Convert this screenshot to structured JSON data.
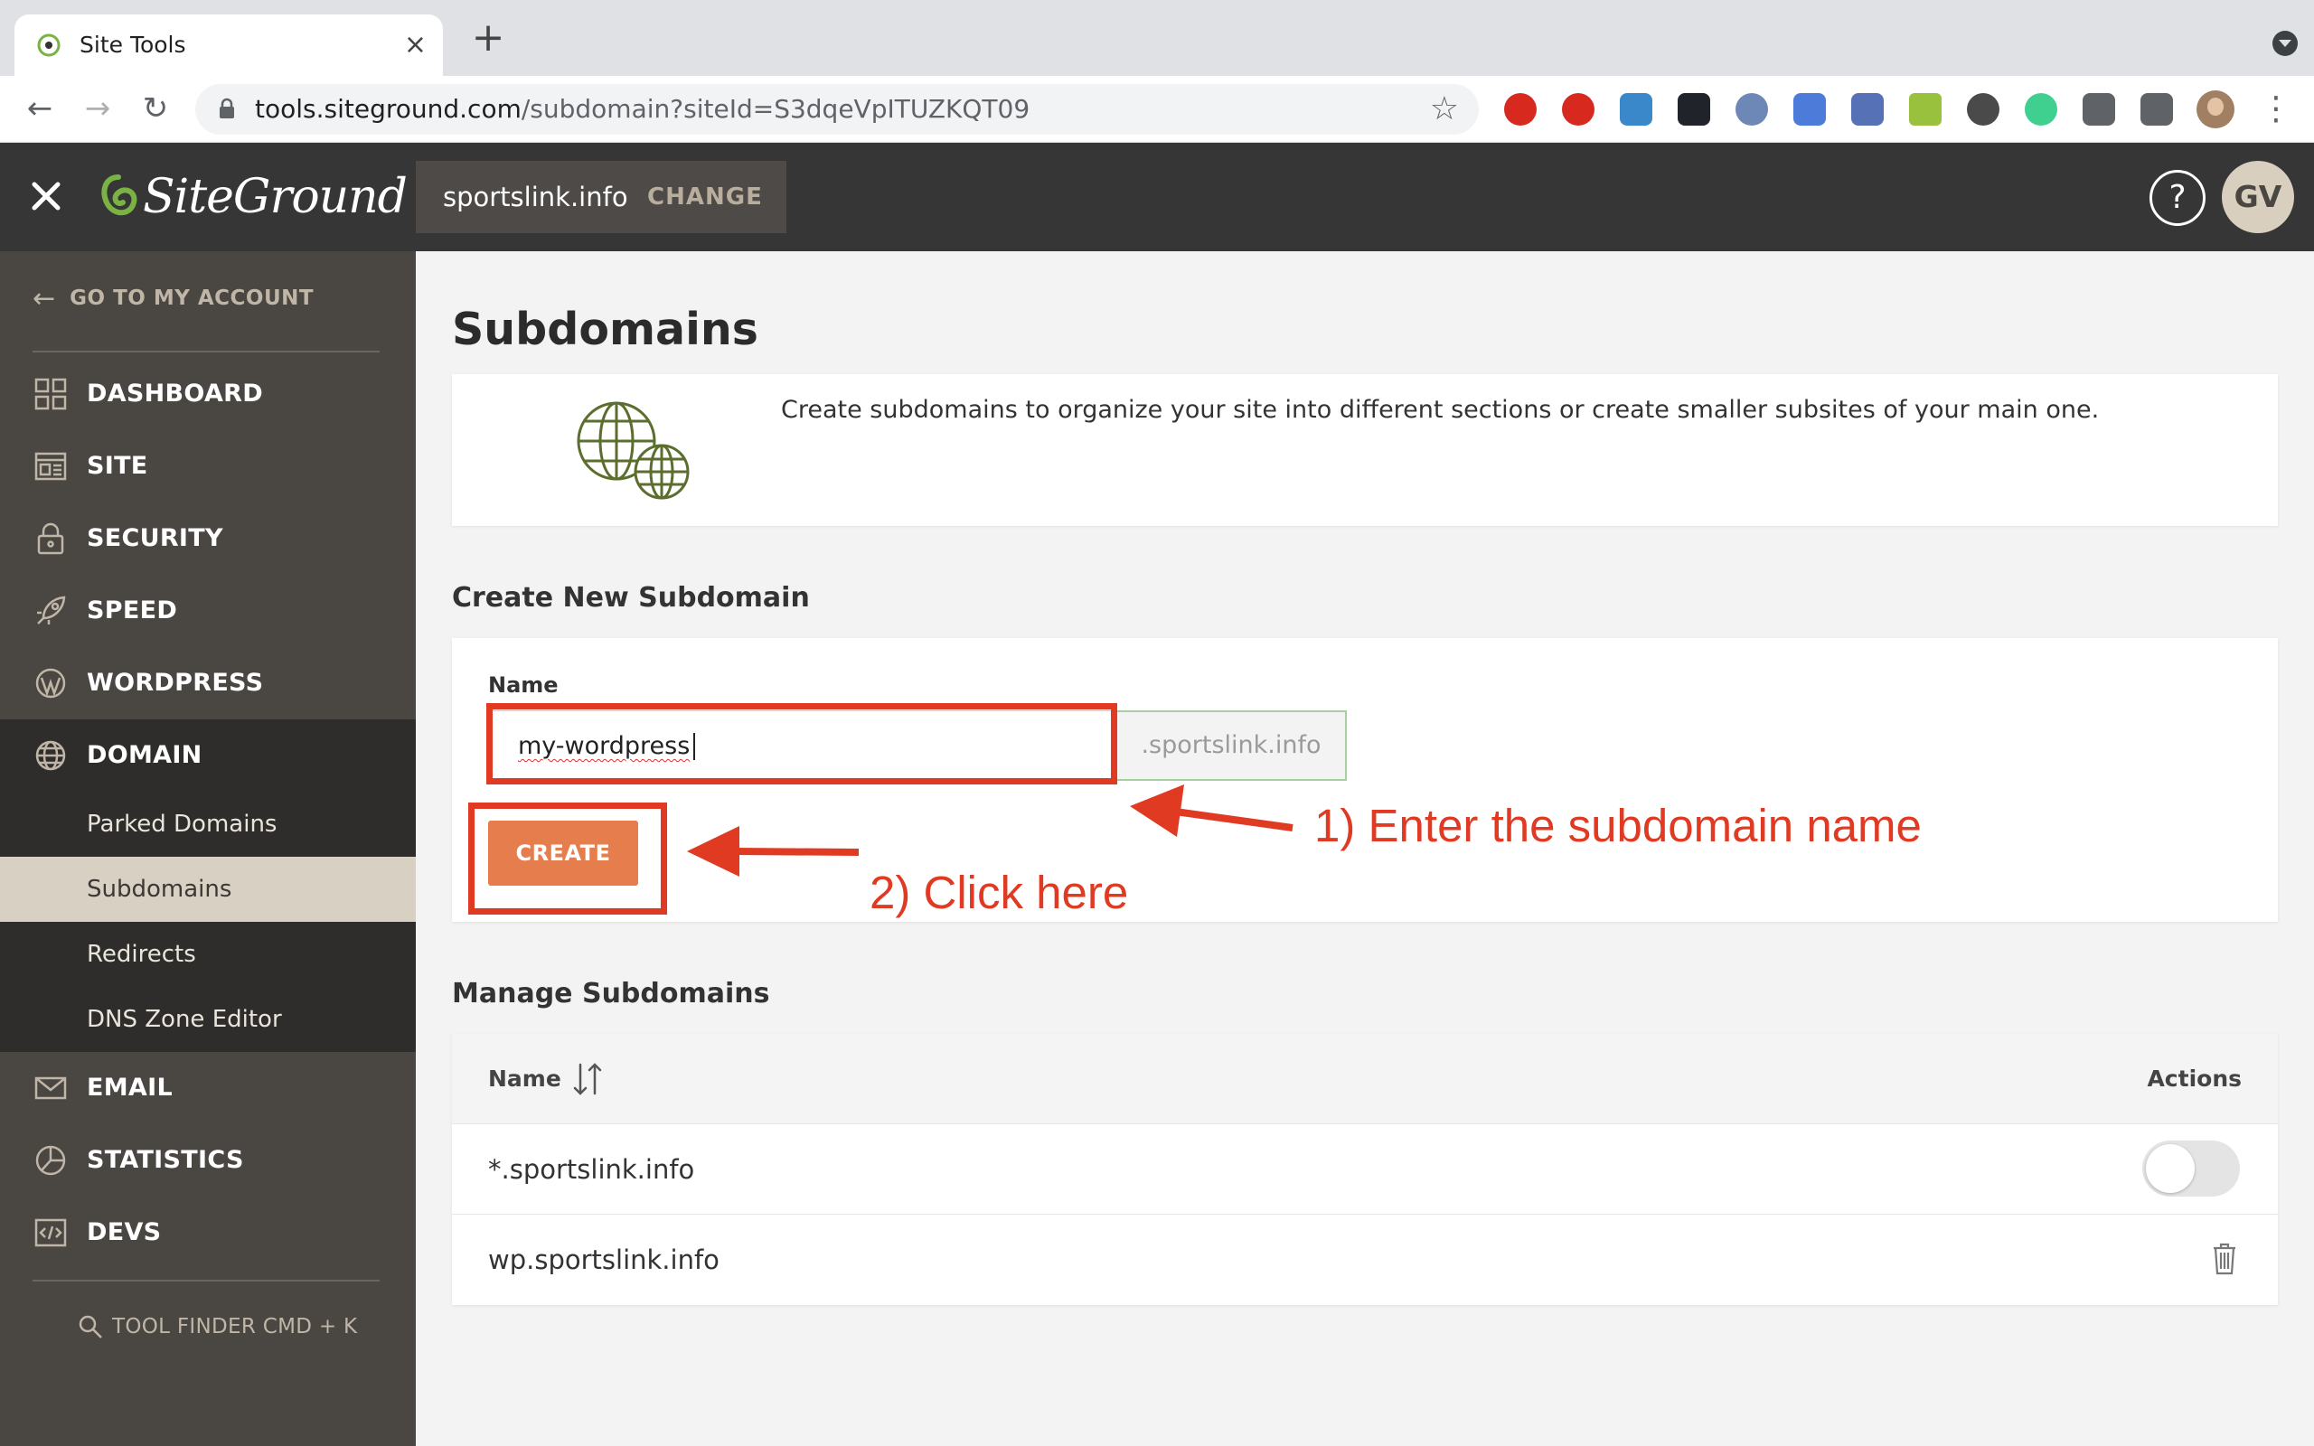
{
  "browser": {
    "tab_title": "Site Tools",
    "tab_close": "×",
    "new_tab": "+",
    "url_host": "tools.siteground.com",
    "url_path": "/subdomain?siteId=S3dqeVpITUZKQT09"
  },
  "header": {
    "logo_text": "SiteGround",
    "site_name": "sportslink.info",
    "change_label": "CHANGE",
    "help_label": "?",
    "user_initials": "GV"
  },
  "sidebar": {
    "back_label": "GO TO MY ACCOUNT",
    "items": [
      {
        "label": "DASHBOARD"
      },
      {
        "label": "SITE"
      },
      {
        "label": "SECURITY"
      },
      {
        "label": "SPEED"
      },
      {
        "label": "WORDPRESS"
      },
      {
        "label": "DOMAIN"
      },
      {
        "label": "EMAIL"
      },
      {
        "label": "STATISTICS"
      },
      {
        "label": "DEVS"
      }
    ],
    "domain_subitems": [
      {
        "label": "Parked Domains"
      },
      {
        "label": "Subdomains"
      },
      {
        "label": "Redirects"
      },
      {
        "label": "DNS Zone Editor"
      }
    ],
    "tool_finder": "TOOL FINDER CMD + K"
  },
  "main": {
    "title": "Subdomains",
    "intro": "Create subdomains to organize your site into different sections or create smaller subsites of your main one.",
    "create_section": {
      "title": "Create New Subdomain",
      "name_label": "Name",
      "name_value": "my-wordpress",
      "suffix": ".sportslink.info",
      "create_button": "CREATE"
    },
    "manage_section": {
      "title": "Manage Subdomains",
      "col_name": "Name",
      "col_actions": "Actions",
      "rows": [
        {
          "name": "*.sportslink.info"
        },
        {
          "name": "wp.sportslink.info"
        }
      ]
    }
  },
  "annotations": {
    "step1": "1) Enter the subdomain name",
    "step2": "2) Click here"
  },
  "colors": {
    "accent": "#e67d4c",
    "annotation": "#e03a23",
    "sidebar": "#4a4642",
    "header": "#363636"
  }
}
